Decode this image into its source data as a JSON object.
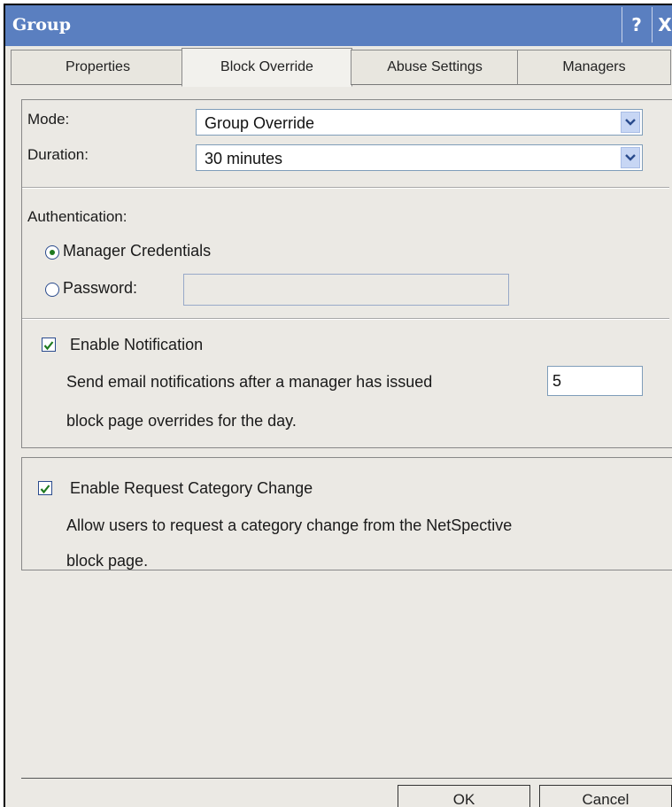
{
  "window": {
    "title": "Group",
    "help_label": "?",
    "close_label": "X"
  },
  "tabs": [
    {
      "label": "Properties",
      "active": false
    },
    {
      "label": "Block Override",
      "active": true
    },
    {
      "label": "Abuse Settings",
      "active": false
    },
    {
      "label": "Managers",
      "active": false
    }
  ],
  "override": {
    "mode_label": "Mode:",
    "mode_value": "Group Override",
    "duration_label": "Duration:",
    "duration_value": "30 minutes",
    "authentication_label": "Authentication:",
    "auth_options": [
      {
        "label": "Manager Credentials",
        "selected": true
      },
      {
        "label": "Password:",
        "selected": false
      }
    ],
    "password_value": ""
  },
  "notification": {
    "checkbox_label": "Enable Notification",
    "checked": true,
    "text_before": "Send email notifications after a manager has issued",
    "count_value": "5",
    "text_after": "block page overrides for the day."
  },
  "category_change": {
    "checkbox_label": "Enable Request Category Change",
    "checked": true,
    "text_line1": "Allow users to request a category change from the NetSpective",
    "text_line2": "block page."
  },
  "footer": {
    "ok_label": "OK",
    "cancel_label": "Cancel"
  },
  "colors": {
    "titlebar": "#5a7fc0",
    "panel": "#ebe9e4",
    "check_accent": "#1f7a1f"
  }
}
